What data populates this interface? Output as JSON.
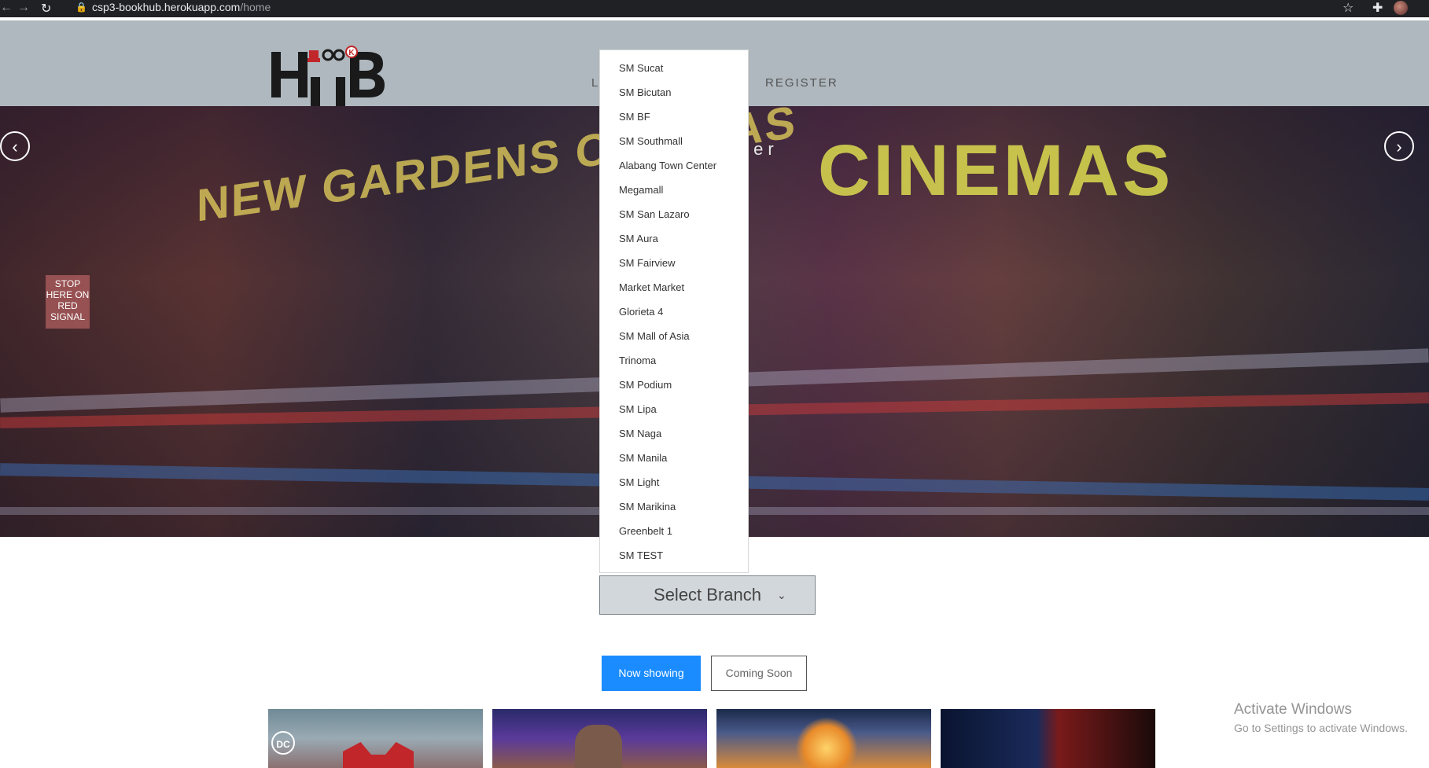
{
  "browser": {
    "url_host": "csp3-bookhub.herokuapp.com",
    "url_path": "/home",
    "icons": [
      "back-icon",
      "forward-icon",
      "reload-icon",
      "lock-icon",
      "star-icon",
      "extensions-icon"
    ]
  },
  "navbar": {
    "logo_text": "HUB",
    "partial_link": "L",
    "register": "REGISTER"
  },
  "hero": {
    "title_partial": "ter",
    "sign_left": "NEW GARDENS CINEMAS",
    "sign_right": "CINEMAS",
    "stop_sign": "STOP HERE ON RED SIGNAL",
    "prev_arrow": "‹",
    "next_arrow": "›"
  },
  "branch_dropdown": {
    "items": [
      "SM Sucat",
      "SM Bicutan",
      "SM BF",
      "SM Southmall",
      "Alabang Town Center",
      "Megamall",
      "SM San Lazaro",
      "SM Aura",
      "SM Fairview",
      "Market Market",
      "Glorieta 4",
      "SM Mall of Asia",
      "Trinoma",
      "SM Podium",
      "SM Lipa",
      "SM Naga",
      "SM Manila",
      "SM Light",
      "SM Marikina",
      "Greenbelt 1",
      "SM TEST"
    ]
  },
  "select_branch": {
    "label": "Select Branch",
    "caret": "⌄"
  },
  "tabs": {
    "now_showing": "Now showing",
    "coming_soon": "Coming Soon",
    "active": "now_showing",
    "active_color": "#1a8cff"
  },
  "posters": {
    "p1_badge": "DC"
  },
  "watermark": {
    "title": "Activate Windows",
    "subtitle": "Go to Settings to activate Windows."
  }
}
